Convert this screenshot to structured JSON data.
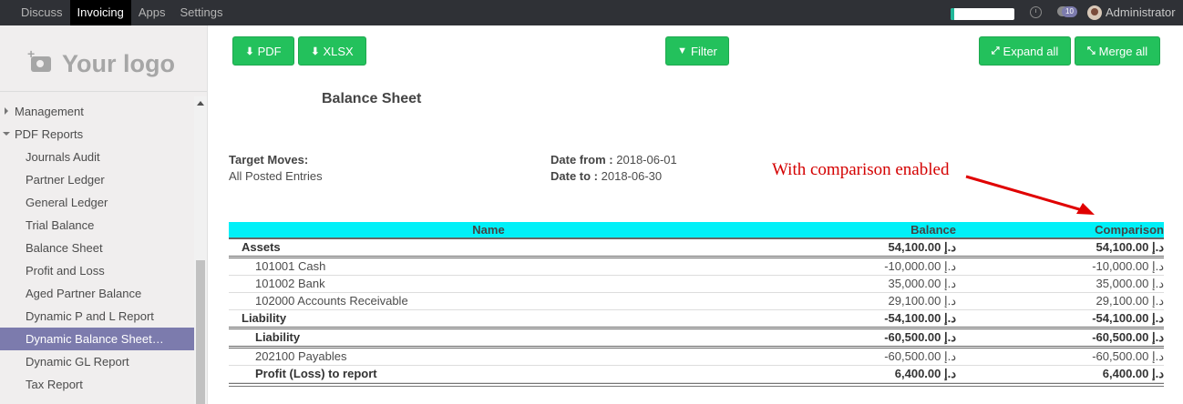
{
  "topbar": {
    "menu": [
      "Discuss",
      "Invoicing",
      "Apps",
      "Settings"
    ],
    "active": "Invoicing",
    "progress": 0.05,
    "chat_badge": "10",
    "user": "Administrator"
  },
  "sidebar": {
    "logo_text": "Your logo",
    "items": [
      {
        "label": "Management",
        "level": 0,
        "state": "collapsed"
      },
      {
        "label": "PDF Reports",
        "level": 0,
        "state": "expanded"
      },
      {
        "label": "Journals Audit",
        "level": 1
      },
      {
        "label": "Partner Ledger",
        "level": 1
      },
      {
        "label": "General Ledger",
        "level": 1
      },
      {
        "label": "Trial Balance",
        "level": 1
      },
      {
        "label": "Balance Sheet",
        "level": 1
      },
      {
        "label": "Profit and Loss",
        "level": 1
      },
      {
        "label": "Aged Partner Balance",
        "level": 1
      },
      {
        "label": "Dynamic P and L Report",
        "level": 1
      },
      {
        "label": "Dynamic Balance Sheet…",
        "level": 1,
        "active": true
      },
      {
        "label": "Dynamic GL Report",
        "level": 1
      },
      {
        "label": "Tax Report",
        "level": 1
      }
    ]
  },
  "toolbar": {
    "pdf": "PDF",
    "xlsx": "XLSX",
    "filter": "Filter",
    "expand_all": "Expand all",
    "merge_all": "Merge all"
  },
  "report": {
    "title": "Balance Sheet",
    "target_moves_label": "Target Moves:",
    "target_moves_value": "All Posted Entries",
    "date_from_label": "Date from :",
    "date_from": "2018-06-01",
    "date_to_label": "Date to :",
    "date_to": "2018-06-30",
    "annotation": "With comparison enabled",
    "columns": {
      "name": "Name",
      "balance": "Balance",
      "comparison": "Comparison"
    },
    "rows": [
      {
        "name": "Assets",
        "balance": "54,100.00 د.إ",
        "comparison": "54,100.00 د.إ",
        "level": 1,
        "bold": true,
        "double": true
      },
      {
        "name": "101001 Cash",
        "balance": "-10,000.00 د.إ",
        "comparison": "-10,000.00 د.إ",
        "level": 2,
        "bold": false
      },
      {
        "name": "101002 Bank",
        "balance": "35,000.00 د.إ",
        "comparison": "35,000.00 د.إ",
        "level": 2,
        "bold": false
      },
      {
        "name": "102000 Accounts Receivable",
        "balance": "29,100.00 د.إ",
        "comparison": "29,100.00 د.إ",
        "level": 2,
        "bold": false
      },
      {
        "name": "Liability",
        "balance": "-54,100.00 د.إ",
        "comparison": "-54,100.00 د.إ",
        "level": 1,
        "bold": true,
        "double": true
      },
      {
        "name": "Liability",
        "balance": "-60,500.00 د.إ",
        "comparison": "-60,500.00 د.إ",
        "level": 2,
        "bold": true,
        "double": true
      },
      {
        "name": "202100 Payables",
        "balance": "-60,500.00 د.إ",
        "comparison": "-60,500.00 د.إ",
        "level": 2,
        "bold": false
      },
      {
        "name": "Profit (Loss) to report",
        "balance": "6,400.00 د.إ",
        "comparison": "6,400.00 د.إ",
        "level": 2,
        "bold": true
      }
    ]
  },
  "colors": {
    "accent": "#7c7bad",
    "button": "#23c15c",
    "header": "#00f0f8",
    "annotation": "#d40000"
  }
}
